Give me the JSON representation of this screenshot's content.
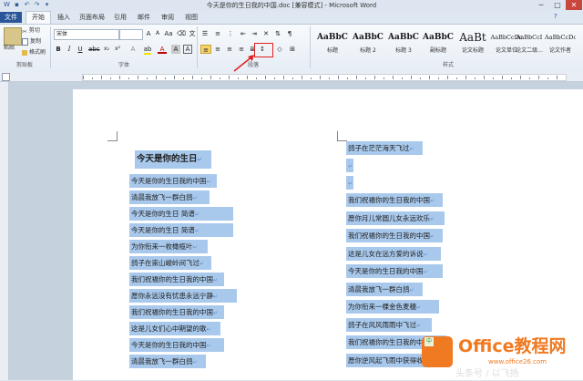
{
  "window": {
    "title": "今天是你的生日我的中国.doc [兼容模式] - Microsoft Word",
    "minimize": "─",
    "maximize": "□",
    "close": "✕"
  },
  "tabs": [
    {
      "label": "文件",
      "active": false
    },
    {
      "label": "开始",
      "active": true
    },
    {
      "label": "插入",
      "active": false
    },
    {
      "label": "页面布局",
      "active": false
    },
    {
      "label": "引用",
      "active": false
    },
    {
      "label": "邮件",
      "active": false
    },
    {
      "label": "审阅",
      "active": false
    },
    {
      "label": "视图",
      "active": false
    }
  ],
  "clipboard": {
    "paste": "粘贴",
    "cut": "剪切",
    "copy": "复制",
    "format_painter": "格式刷",
    "group_label": "剪贴板"
  },
  "font": {
    "name": "宋体",
    "size": "",
    "group_label": "字体",
    "bold": "B",
    "italic": "I",
    "underline": "U",
    "color_a": "A"
  },
  "paragraph": {
    "group_label": "段落"
  },
  "styles": {
    "group_label": "样式",
    "items": [
      {
        "sample": "AaBbC",
        "name": "标题"
      },
      {
        "sample": "AaBbC",
        "name": "标题 2"
      },
      {
        "sample": "AaBbC",
        "name": "标题 3"
      },
      {
        "sample": "AaBbC",
        "name": "副标题"
      },
      {
        "sample": "AaBt",
        "name": "论文标题"
      },
      {
        "sample": "AaBbCcDc",
        "name": "论文单位"
      },
      {
        "sample": "AaBbCcI",
        "name": "论文二级..."
      },
      {
        "sample": "AaBbCcDc",
        "name": "论文作者"
      }
    ]
  },
  "document": {
    "heading": "今天是你的生日",
    "column1": [
      "今天是你的生日我的中国",
      "清晨我放飞一群白鸽",
      "今天是你的生日  简谱",
      "今天是你的生日  简谱",
      "为你衔来一枚橄榄叶",
      "鸽子在崇山峻岭间飞过",
      "我们祝福你的生日我的中国",
      "愿你永远没有忧患永远宁静",
      "我们祝福你的生日我的中国",
      "这是儿女们心中期望的歌",
      "今天是你的生日我的中国",
      "清晨我放飞一群白鸽"
    ],
    "column2": [
      "鸽子在茫茫海天飞过",
      "",
      "",
      "我们祝福你的生日我的中国",
      "愿你月儿常圆儿女永远欢乐",
      "我们祝福你的生日我的中国",
      "这是儿女在远方爱的诉说",
      "今天是你的生日我的中国",
      "清晨我放飞一群白鸽",
      "为你衔来一棵金色麦穗",
      "鸽子在风风雨雨中飞过",
      "我们祝福你的生日我的中国",
      "愿你逆风起飞雨中获得收获"
    ],
    "para_mark": "↵"
  },
  "watermark": {
    "brand": "Office教程网",
    "url": "www.office26.com",
    "badge": "中",
    "sub": "头条号 / 以飞扬"
  }
}
